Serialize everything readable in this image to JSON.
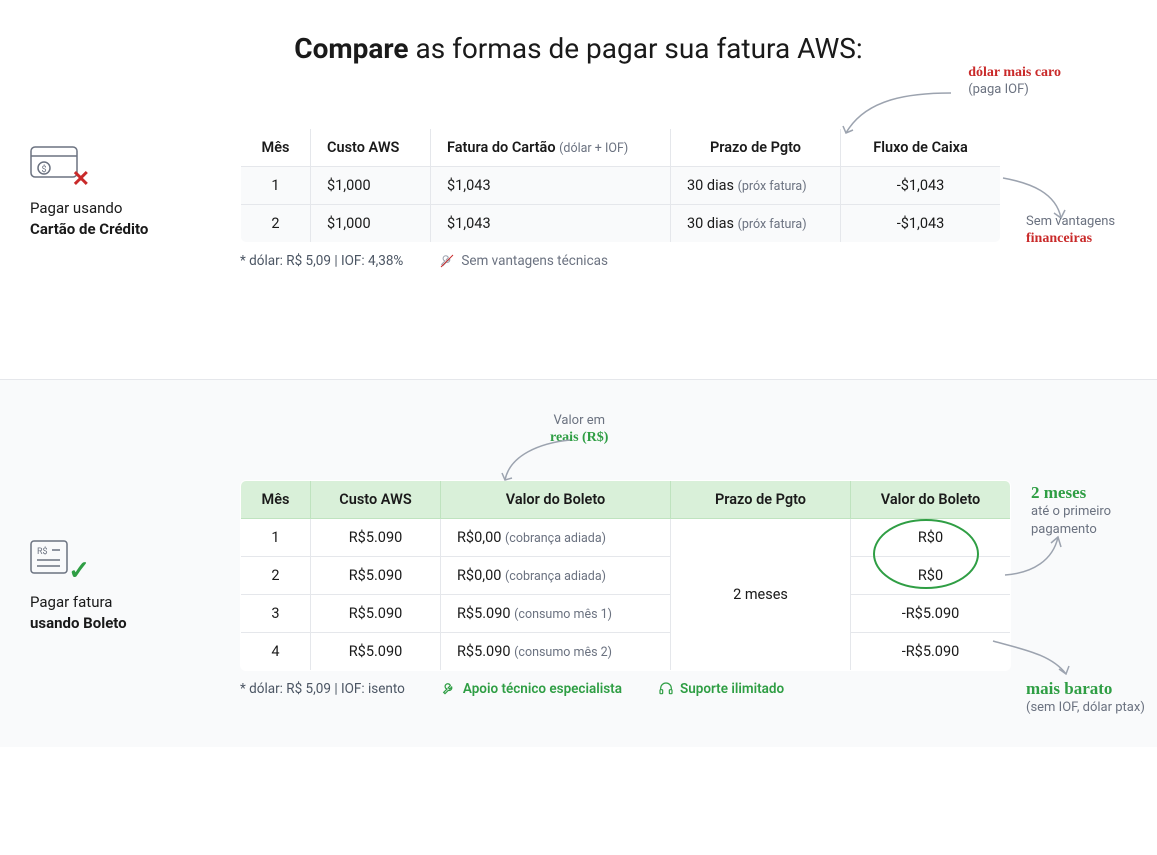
{
  "heading": {
    "bold": "Compare",
    "rest": " as formas de pagar sua fatura AWS:"
  },
  "section1": {
    "label_line1": "Pagar usando",
    "label_line2": "Cartão de Crédito",
    "icon_name": "credit-card",
    "headers": {
      "mes": "Mês",
      "custo": "Custo AWS",
      "fatura": "Fatura do Cartão",
      "fatura_hint": "(dólar + IOF)",
      "prazo": "Prazo de Pgto",
      "fluxo": "Fluxo de Caixa"
    },
    "rows": [
      {
        "mes": "1",
        "custo": "$1,000",
        "fatura": "$1,043",
        "prazo": "30 dias",
        "prazo_hint": "(próx fatura)",
        "fluxo": "-$1,043"
      },
      {
        "mes": "2",
        "custo": "$1,000",
        "fatura": "$1,043",
        "prazo": "30 dias",
        "prazo_hint": "(próx fatura)",
        "fluxo": "-$1,043"
      }
    ],
    "disclaimer": "* dólar: R$ 5,09 | IOF: 4,38%",
    "neutral_adv": "Sem vantagens técnicas",
    "annot_top": {
      "hand": "dólar mais caro",
      "sub": "(paga IOF)"
    },
    "annot_right": {
      "line1": "Sem vantagens",
      "hand": "financeiras"
    }
  },
  "section2": {
    "label_line1": "Pagar fatura",
    "label_line2": "usando Boleto",
    "icon_name": "boleto",
    "annot_top": {
      "line1": "Valor em",
      "hand": "reais (R$)"
    },
    "headers": {
      "mes": "Mês",
      "custo": "Custo AWS",
      "valor": "Valor do Boleto",
      "prazo": "Prazo de Pgto",
      "valor2": "Valor do Boleto"
    },
    "rows": [
      {
        "mes": "1",
        "custo": "R$5.090",
        "valor": "R$0,00",
        "valor_hint": "(cobrança adiada)",
        "vb": "R$0"
      },
      {
        "mes": "2",
        "custo": "R$5.090",
        "valor": "R$0,00",
        "valor_hint": "(cobrança adiada)",
        "vb": "R$0"
      },
      {
        "mes": "3",
        "custo": "R$5.090",
        "valor": "R$5.090",
        "valor_hint": "(consumo mês 1)",
        "vb": "-R$5.090"
      },
      {
        "mes": "4",
        "custo": "R$5.090",
        "valor": "R$5.090",
        "valor_hint": "(consumo mês 2)",
        "vb": "-R$5.090"
      }
    ],
    "prazo_merged": "2 meses",
    "disclaimer": "* dólar: R$ 5,09 | IOF: isento",
    "adv1": "Apoio técnico especialista",
    "adv2": "Suporte ilimitado",
    "annot_right_top": {
      "hand": "2 meses",
      "sub1": "até o primeiro",
      "sub2": "pagamento"
    },
    "annot_right_bottom": {
      "hand": "mais barato",
      "sub": "(sem IOF, dólar ptax)"
    }
  }
}
